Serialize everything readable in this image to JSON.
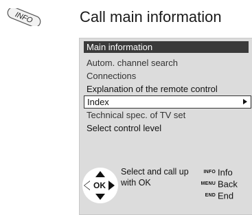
{
  "info_badge": {
    "label": "INFO"
  },
  "page": {
    "title": "Call main information"
  },
  "menu": {
    "header": "Main information",
    "items": [
      {
        "label": "Autom. channel search"
      },
      {
        "label": "Connections"
      },
      {
        "label": "Explanation of the remote control"
      },
      {
        "label": "Index"
      },
      {
        "label": "Technical spec. of TV set"
      },
      {
        "label": "Select control level"
      }
    ],
    "selected_index": 3
  },
  "help": {
    "ok_label": "OK",
    "instruction": "Select and call up with OK",
    "keys": [
      {
        "tag": "INFO",
        "desc": "Info"
      },
      {
        "tag": "MENU",
        "desc": "Back"
      },
      {
        "tag": "END",
        "desc": "End"
      }
    ]
  }
}
